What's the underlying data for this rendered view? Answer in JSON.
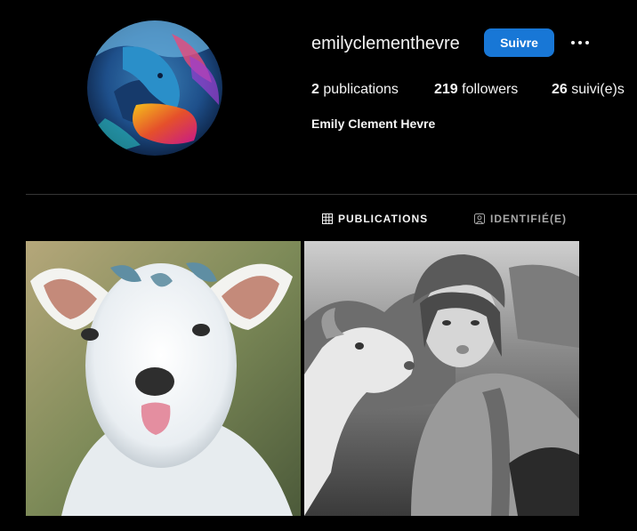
{
  "profile": {
    "username": "emilyclementhevre",
    "full_name": "Emily Clement Hevre",
    "follow_label": "Suivre",
    "more_icon": "more-dots-icon",
    "stats": {
      "posts_count": "2",
      "posts_label": "publications",
      "followers_count": "219",
      "followers_label": "followers",
      "following_count": "26",
      "following_label": "suivi(e)s"
    }
  },
  "tabs": [
    {
      "label": "PUBLICATIONS",
      "icon": "grid-icon",
      "active": true
    },
    {
      "label": "IDENTIFIÉ(E)",
      "icon": "tagged-user-icon",
      "active": false
    }
  ],
  "posts": [
    {
      "subject": "baby goat sticking out tongue"
    },
    {
      "subject": "woman in helmet with goat, black and white"
    }
  ],
  "colors": {
    "background": "#000000",
    "accent": "#1877d6",
    "text": "#f5f5f5",
    "muted": "#a8a8a8",
    "divider": "#363636"
  }
}
